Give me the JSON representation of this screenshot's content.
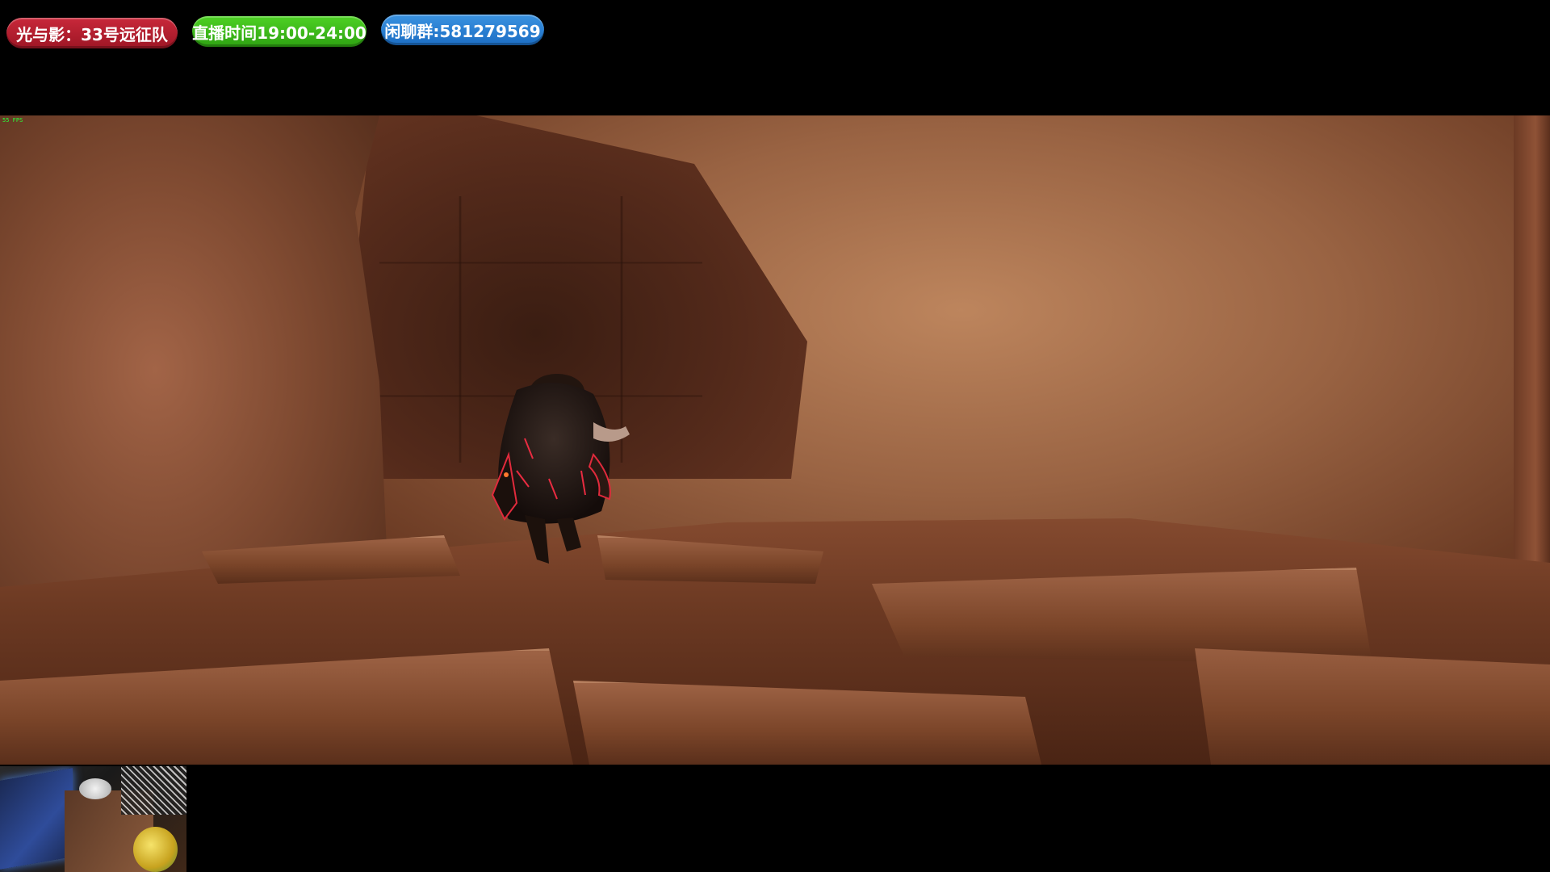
{
  "overlay": {
    "badges": [
      {
        "label": "光与影：33号远征队",
        "color": "#b41e2f"
      },
      {
        "label": "直播时间19:00-24:00",
        "color": "#3cbc1a"
      },
      {
        "label": "闲聊群:581279569",
        "color": "#2a82d6"
      }
    ]
  },
  "game": {
    "scene": "cave-interior",
    "fps_readout": "55 FPS"
  },
  "webcam": {
    "visible": true
  }
}
